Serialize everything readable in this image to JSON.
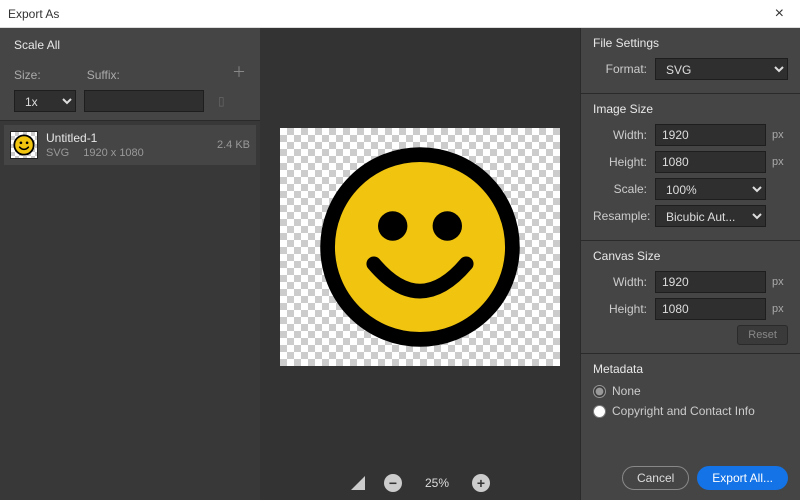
{
  "window": {
    "title": "Export As"
  },
  "scale": {
    "heading": "Scale All",
    "size_label": "Size:",
    "suffix_label": "Suffix:",
    "size_value": "1x",
    "suffix_value": ""
  },
  "file": {
    "name": "Untitled-1",
    "format": "SVG",
    "dimensions": "1920 x 1080",
    "filesize": "2.4 KB"
  },
  "zoom": {
    "level": "25%"
  },
  "fileSettings": {
    "heading": "File Settings",
    "format_label": "Format:",
    "format_value": "SVG"
  },
  "imageSize": {
    "heading": "Image Size",
    "width_label": "Width:",
    "height_label": "Height:",
    "scale_label": "Scale:",
    "resample_label": "Resample:",
    "width": "1920",
    "height": "1080",
    "scale": "100%",
    "resample": "Bicubic Aut...",
    "px": "px"
  },
  "canvasSize": {
    "heading": "Canvas Size",
    "width_label": "Width:",
    "height_label": "Height:",
    "width": "1920",
    "height": "1080",
    "px": "px",
    "reset": "Reset"
  },
  "metadata": {
    "heading": "Metadata",
    "none": "None",
    "copyright": "Copyright and Contact Info"
  },
  "buttons": {
    "cancel": "Cancel",
    "export": "Export All..."
  }
}
